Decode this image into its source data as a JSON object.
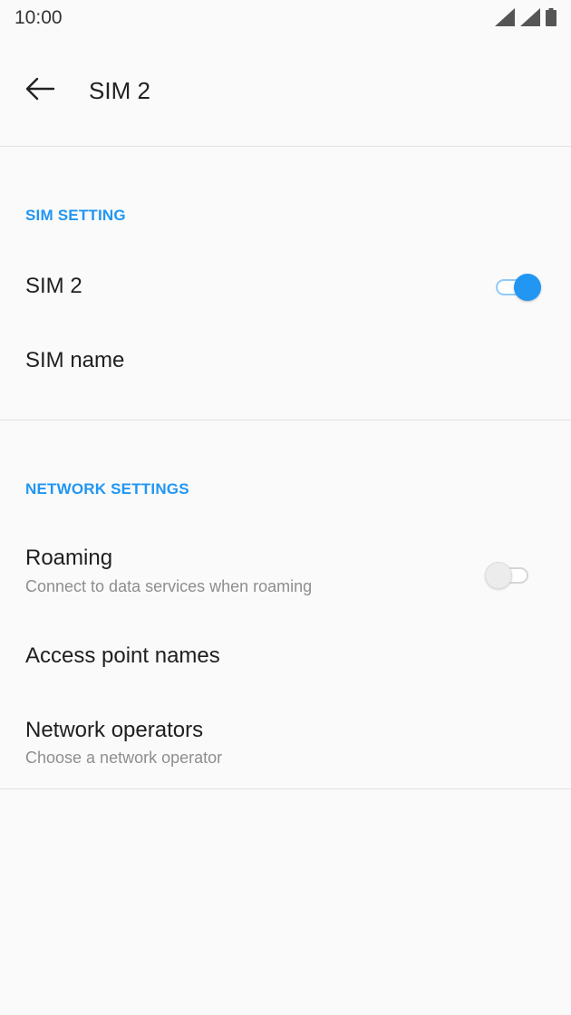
{
  "status_bar": {
    "time": "10:00",
    "icons": [
      "signal-icon",
      "signal-icon",
      "battery-icon"
    ]
  },
  "app_bar": {
    "title": "SIM 2",
    "back_icon": "arrow-left-icon"
  },
  "sections": {
    "sim_setting": {
      "header": "SIM SETTING",
      "sim_toggle": {
        "title": "SIM 2",
        "on": true
      },
      "sim_name": {
        "title": "SIM name"
      }
    },
    "network_settings": {
      "header": "NETWORK SETTINGS",
      "roaming": {
        "title": "Roaming",
        "subtitle": "Connect to data services when roaming",
        "on": false
      },
      "apn": {
        "title": "Access point names"
      },
      "operators": {
        "title": "Network operators",
        "subtitle": "Choose a network operator"
      }
    }
  },
  "colors": {
    "accent": "#2196f3",
    "background": "#fafafa",
    "divider": "#e2e2e2",
    "secondary_text": "#8e8e8e"
  }
}
